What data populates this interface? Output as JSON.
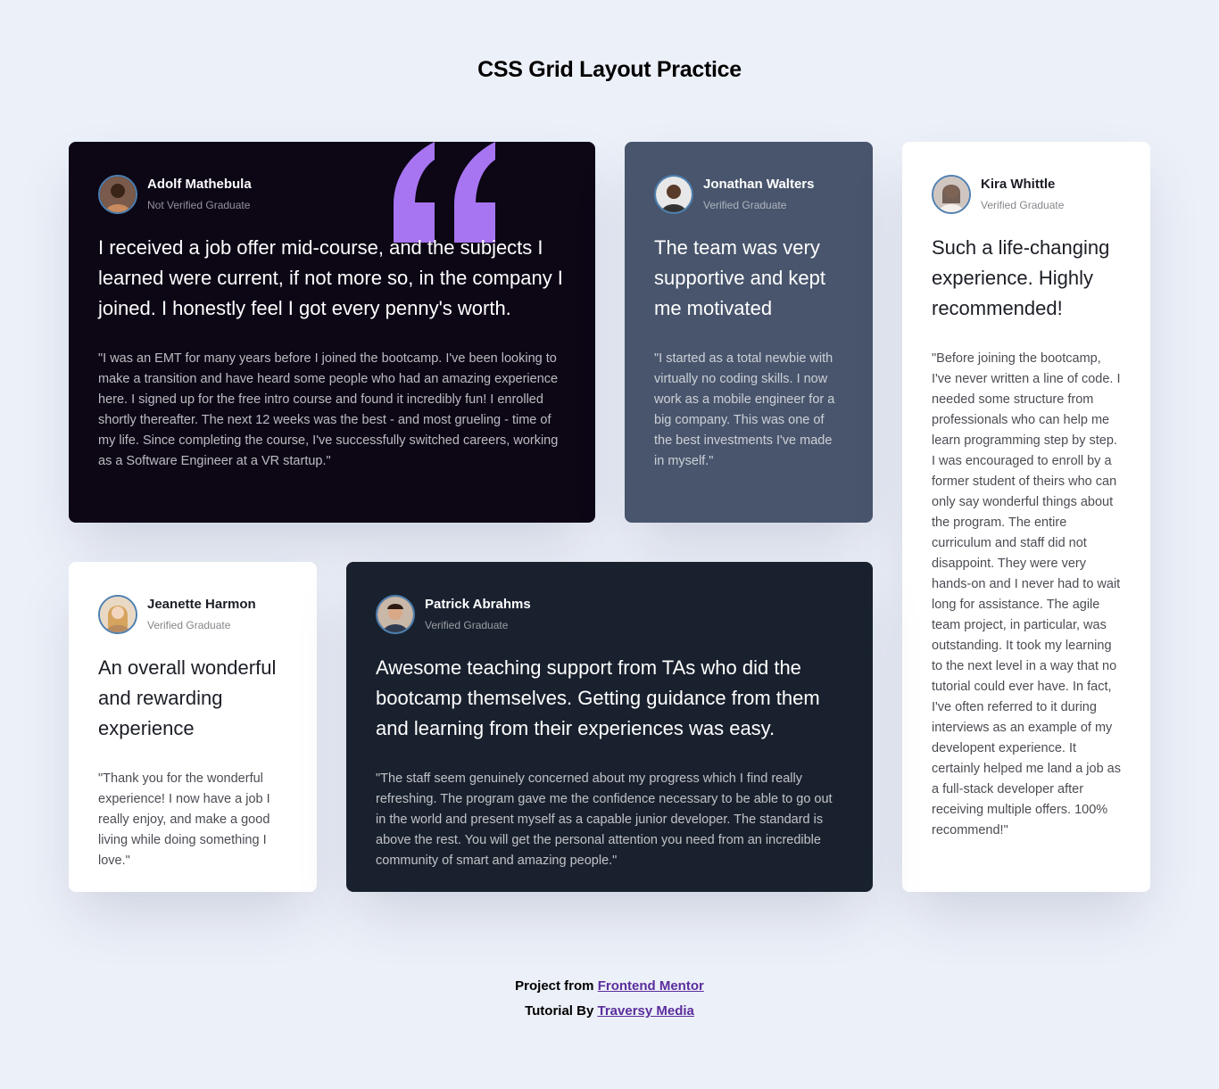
{
  "page": {
    "title": "CSS Grid Layout Practice",
    "background": "#ecf0f8"
  },
  "colors": {
    "quote_accent": "#a775f1",
    "avatar_border": "#4d7fb0",
    "link": "#5b2d9c"
  },
  "testimonials": [
    {
      "name": "Adolf Mathebula",
      "status": "Not Verified Graduate",
      "headline": "I received a job offer mid-course, and the subjects I learned were current, if not more so, in the company I joined. I honestly feel I got every penny's worth.",
      "body": "\"I was an EMT for many years before I joined the bootcamp. I've been looking to make a transition and have heard some people who had an amazing experience here. I signed up for the free intro course and found it incredibly fun! I enrolled shortly thereafter. The next 12 weeks was the best - and most grueling - time of my life. Since completing the course, I've successfully switched careers, working as a Software Engineer at a VR startup.\"",
      "background": "#0c0615",
      "avatar_icon": "person-avatar-icon"
    },
    {
      "name": "Jonathan Walters",
      "status": "Verified Graduate",
      "headline": "The team was very supportive and kept me motivated",
      "body": "\"I started as a total newbie with virtually no coding skills. I now work as a mobile engineer for a big company. This was one of the best investments I've made in myself.\"",
      "background": "#48556c",
      "avatar_icon": "person-avatar-icon"
    },
    {
      "name": "Kira Whittle",
      "status": "Verified Graduate",
      "headline": "Such a life-changing experience. Highly recommended!",
      "body": "\"Before joining the bootcamp, I've never written a line of code. I needed some structure from professionals who can help me learn programming step by step. I was encouraged to enroll by a former student of theirs who can only say wonderful things about the program. The entire curriculum and staff did not disappoint. They were very hands-on and I never had to wait long for assistance. The agile team project, in particular, was outstanding. It took my learning to the next level in a way that no tutorial could ever have. In fact, I've often referred to it during interviews as an example of my developent experience. It certainly helped me land a job as a full-stack developer after receiving multiple offers. 100% recommend!\"",
      "background": "#ffffff",
      "avatar_icon": "person-avatar-icon"
    },
    {
      "name": "Jeanette Harmon",
      "status": "Verified Graduate",
      "headline": "An overall wonderful and rewarding experience",
      "body": "\"Thank you for the wonderful experience! I now have a job I really enjoy, and make a good living while doing something I love.\"",
      "background": "#ffffff",
      "avatar_icon": "person-avatar-icon"
    },
    {
      "name": "Patrick Abrahms",
      "status": "Verified Graduate",
      "headline": "Awesome teaching support from TAs who did the bootcamp themselves. Getting guidance from them and learning from their experiences was easy.",
      "body": "\"The staff seem genuinely concerned about my progress which I find really refreshing. The program gave me the confidence necessary to be able to go out in the world and present myself as a capable junior developer. The standard is above the rest. You will get the personal attention you need from an incredible community of smart and amazing people.\"",
      "background": "#19212e",
      "avatar_icon": "person-avatar-icon"
    }
  ],
  "footer": {
    "project_prefix": "Project from",
    "project_link": "Frontend Mentor",
    "tutorial_prefix": "Tutorial By",
    "tutorial_link": "Traversy Media"
  }
}
